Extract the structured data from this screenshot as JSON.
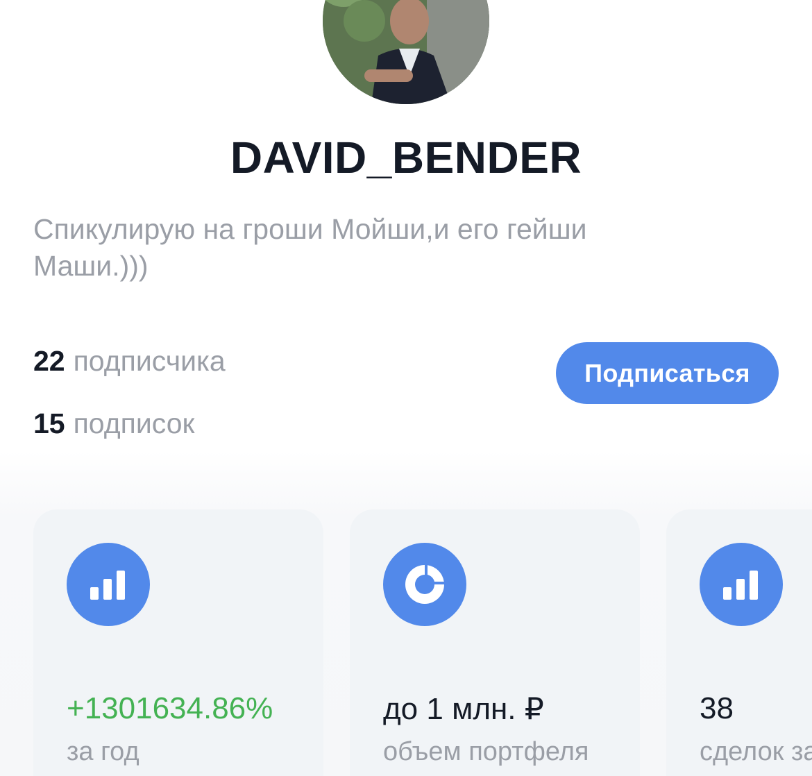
{
  "profile": {
    "username": "DAVID_BENDER",
    "bio": "Спикулирую на гроши Мойши,и его гейши Маши.)))",
    "followers_count": "22",
    "followers_label": "подписчика",
    "following_count": "15",
    "following_label": "подписок",
    "subscribe_label": "Подписаться"
  },
  "stats_cards": [
    {
      "icon": "bar-chart-icon",
      "value": "+1301634.86%",
      "label": "за год"
    },
    {
      "icon": "donut-chart-icon",
      "value": "до 1 млн. ₽",
      "label": "объем портфеля"
    },
    {
      "icon": "bar-chart-icon",
      "value": "38",
      "label": "сделок за"
    }
  ],
  "colors": {
    "accent": "#5289ea",
    "positive": "#44b253",
    "text_primary": "#141a26",
    "text_secondary": "#9a9ea6",
    "card_bg": "#f1f4f7"
  }
}
